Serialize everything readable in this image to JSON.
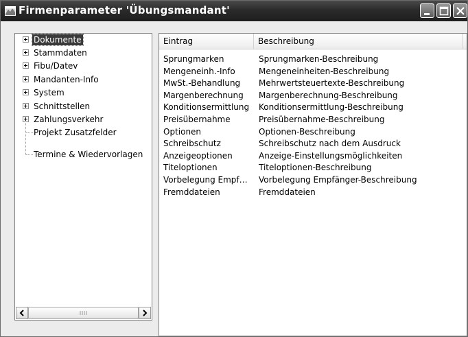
{
  "window": {
    "title": "Firmenparameter 'Übungsmandant'"
  },
  "tree": {
    "items": [
      {
        "label": "Dokumente",
        "expandable": true,
        "selected": true
      },
      {
        "label": "Stammdaten",
        "expandable": true
      },
      {
        "label": "Fibu/Datev",
        "expandable": true
      },
      {
        "label": "Mandanten-Info",
        "expandable": true
      },
      {
        "label": "System",
        "expandable": true
      },
      {
        "label": "Schnittstellen",
        "expandable": true
      },
      {
        "label": "Zahlungsverkehr",
        "expandable": true
      },
      {
        "label": "Projekt Zusatzfelder",
        "expandable": false
      },
      {
        "label": "Termine & Wiedervorlagen",
        "expandable": false
      }
    ]
  },
  "list": {
    "columns": [
      "Eintrag",
      "Beschreibung"
    ],
    "rows": [
      [
        "Sprungmarken",
        "Sprungmarken-Beschreibung"
      ],
      [
        "Mengeneinh.-Info",
        "Mengeneinheiten-Beschreibung"
      ],
      [
        "MwSt.-Behandlung",
        "Mehrwertsteuertexte-Beschreibung"
      ],
      [
        "Margenberechnung",
        "Margenberechnung-Beschreibung"
      ],
      [
        "Konditionsermittlung",
        "Konditionsermittlung-Beschreibung"
      ],
      [
        "Preisübernahme",
        "Preisübernahme-Beschreibung"
      ],
      [
        "Optionen",
        "Optionen-Beschreibung"
      ],
      [
        "Schreibschutz",
        "Schreibschutz nach dem Ausdruck"
      ],
      [
        "Anzeigeoptionen",
        "Anzeige-Einstellungsmöglichkeiten"
      ],
      [
        "Titeloptionen",
        "Titeloptionen-Beschreibung"
      ],
      [
        "Vorbelegung Empf…",
        "Vorbelegung Empfänger-Beschreibung"
      ],
      [
        "Fremddateien",
        "Fremddateien"
      ]
    ]
  },
  "icons": {
    "app": "app-window-icon",
    "minimize": "minimize-icon",
    "maximize": "maximize-icon",
    "close": "close-icon",
    "expand": "plus-expander-icon",
    "scroll_left": "scroll-left-arrow-icon",
    "scroll_right": "scroll-right-arrow-icon"
  }
}
